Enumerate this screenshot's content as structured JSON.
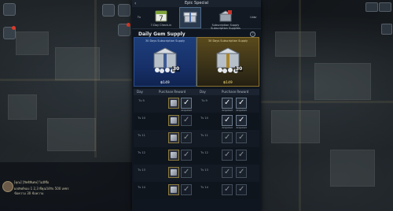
{
  "window": {
    "title": "Epic Special",
    "back_glyph": "‹"
  },
  "tabs": [
    {
      "label": "Tv",
      "name": "prev"
    },
    {
      "label": "7-Day Check-in",
      "name": "checkin",
      "icon_text": "7"
    },
    {
      "label": "",
      "name": "special",
      "active": true
    },
    {
      "label": "Subscription Supply Subscription Supplies",
      "name": "subscription"
    },
    {
      "label": "Unbr",
      "name": "next"
    }
  ],
  "supply": {
    "title": "Daily Gem Supply",
    "info_glyph": "?",
    "cards": [
      {
        "subtitle": "30 Days Subscription Supply",
        "quantity": "30",
        "price": "฿149"
      },
      {
        "subtitle": "30 Days Subscription Supply",
        "quantity": "30",
        "price": "฿149"
      }
    ]
  },
  "table": {
    "headers": [
      "Day",
      "Purchase Reward",
      "Day",
      "Purchase Reward"
    ],
    "rows": [
      {
        "left_day": "Tv 9",
        "right_day": "Tv 9",
        "left_acquired": "Acquired",
        "right_acquired": "Acquired"
      },
      {
        "left_day": "Tv 10",
        "right_day": "Tv 10",
        "left_acquired": "",
        "right_acquired": "Acquired"
      },
      {
        "left_day": "Tv 11",
        "right_day": "Tv 11",
        "left_acquired": "",
        "right_acquired": ""
      },
      {
        "left_day": "Tv 12",
        "right_day": "Tv 12",
        "left_acquired": "",
        "right_acquired": ""
      },
      {
        "left_day": "Tv 13",
        "right_day": "Tv 13",
        "left_acquired": "",
        "right_acquired": ""
      },
      {
        "left_day": "Tv 14",
        "right_day": "Tv 14",
        "left_acquired": "",
        "right_acquired": ""
      }
    ]
  },
  "chat": {
    "lines": [
      "[คุณ] [สิทธิพิเศษ] ไม่มีชื่อ",
      "ผลลัพธ์ของ 1 2,3 ที่คุณได้รับ 500 เพชร",
      "ข้อความ 30 ข้อความ"
    ]
  },
  "colors": {
    "accent_gold": "#ffe27a",
    "card_blue": "#1d3e7a",
    "card_gold": "#5a4a1c"
  }
}
